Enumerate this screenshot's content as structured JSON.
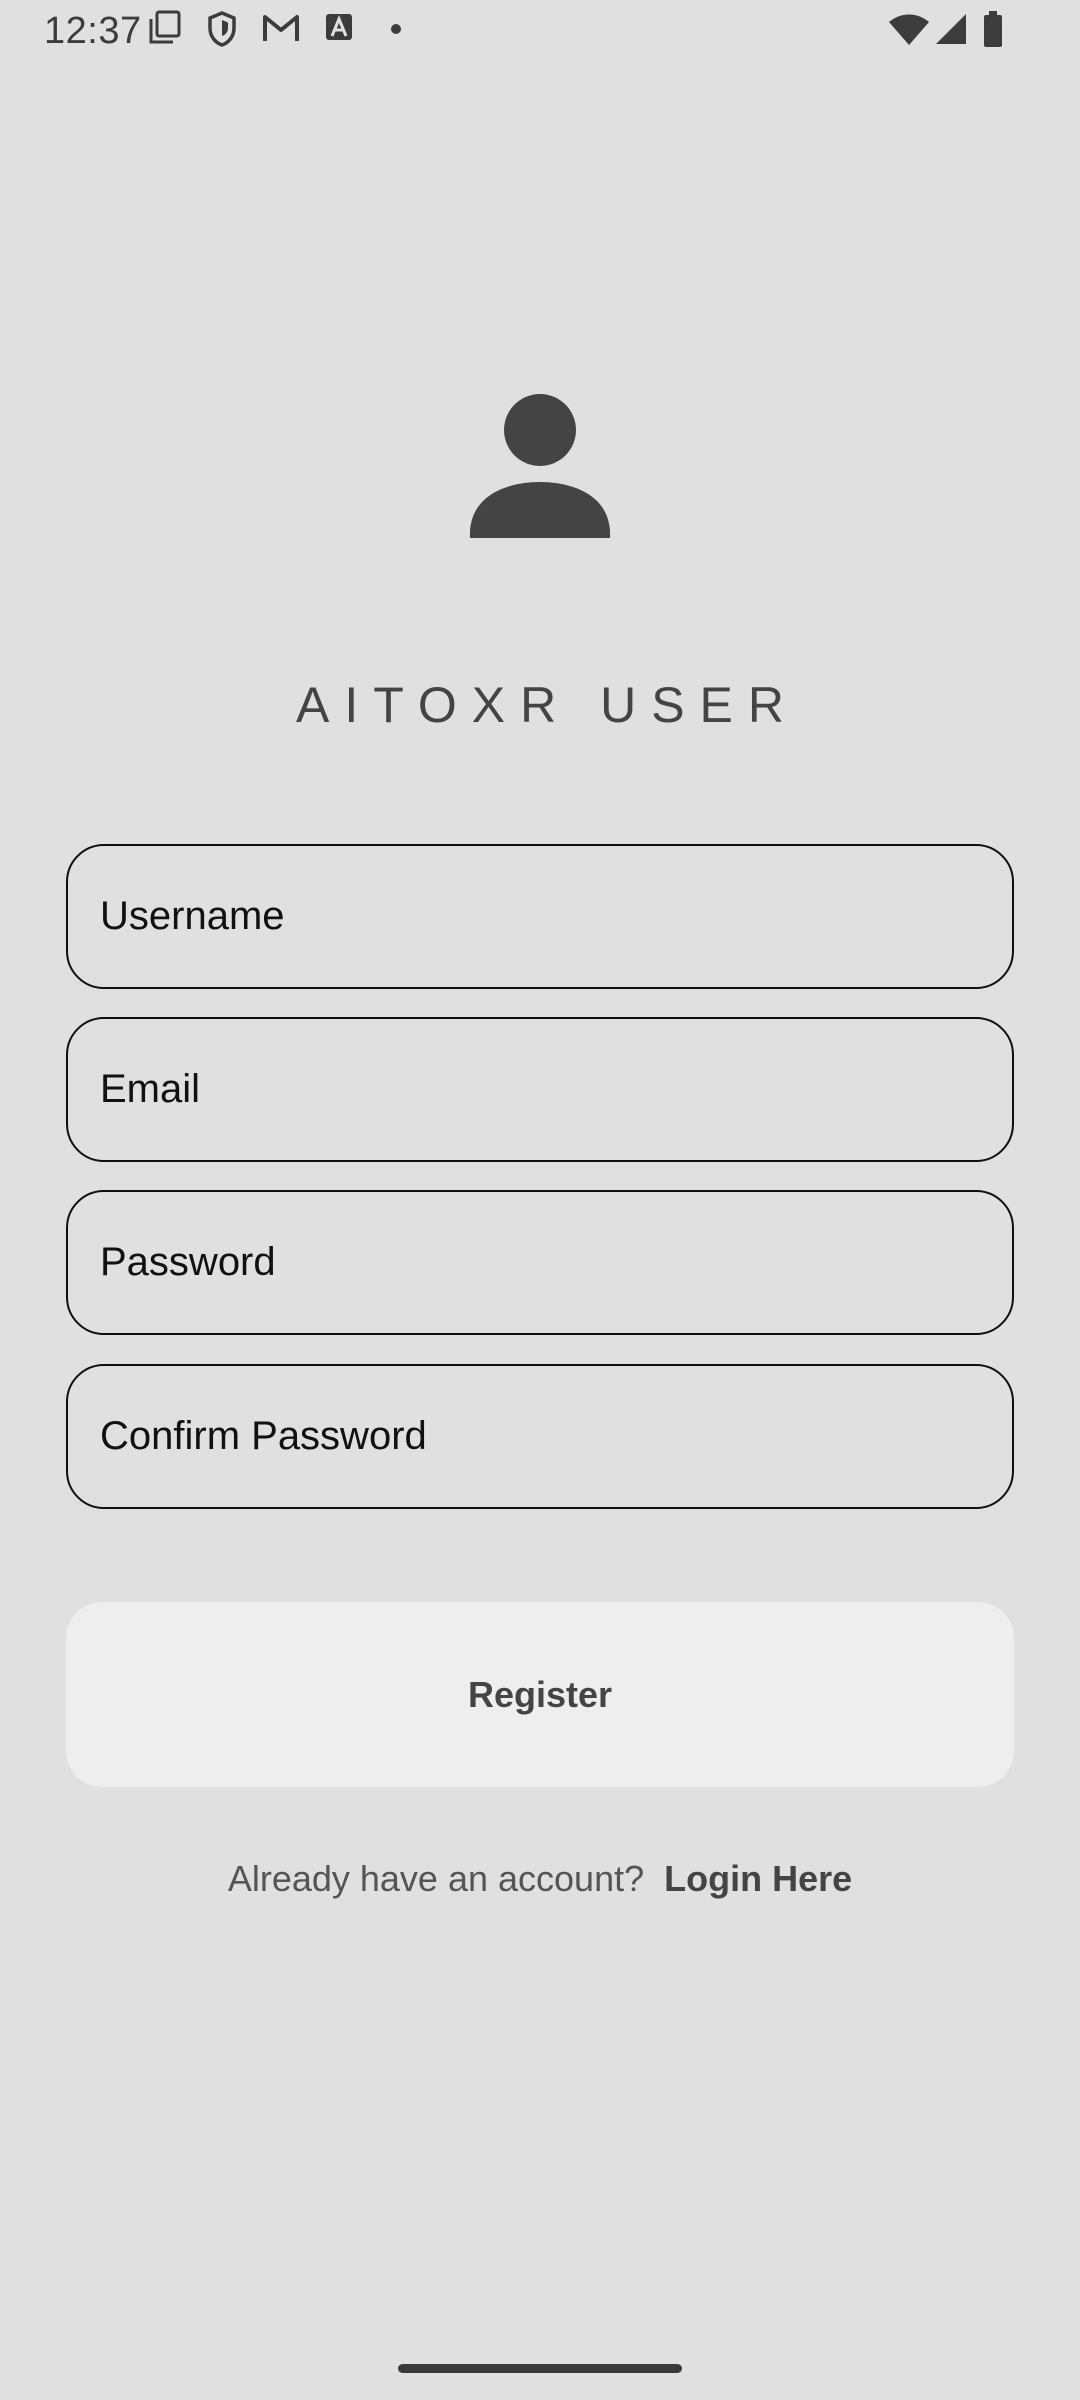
{
  "status_bar": {
    "time": "12:37",
    "notification_icons": [
      "screenshot-icon",
      "shield-icon",
      "gmail-icon",
      "a-square-icon",
      "dot-icon"
    ],
    "system_icons": [
      "wifi-icon",
      "cellular-signal-icon",
      "battery-icon"
    ]
  },
  "header": {
    "avatar_icon": "person-icon",
    "title": "AITOXR USER"
  },
  "form": {
    "username_placeholder": "Username",
    "email_placeholder": "Email",
    "password_placeholder": "Password",
    "confirm_password_placeholder": "Confirm Password",
    "register_label": "Register"
  },
  "footer": {
    "prompt_text": "Already have an account?",
    "login_link_text": "Login Here"
  },
  "colors": {
    "background": "#e0e0e0",
    "button_background": "#eeeeee",
    "field_border": "#101010",
    "title_text": "#444444"
  }
}
